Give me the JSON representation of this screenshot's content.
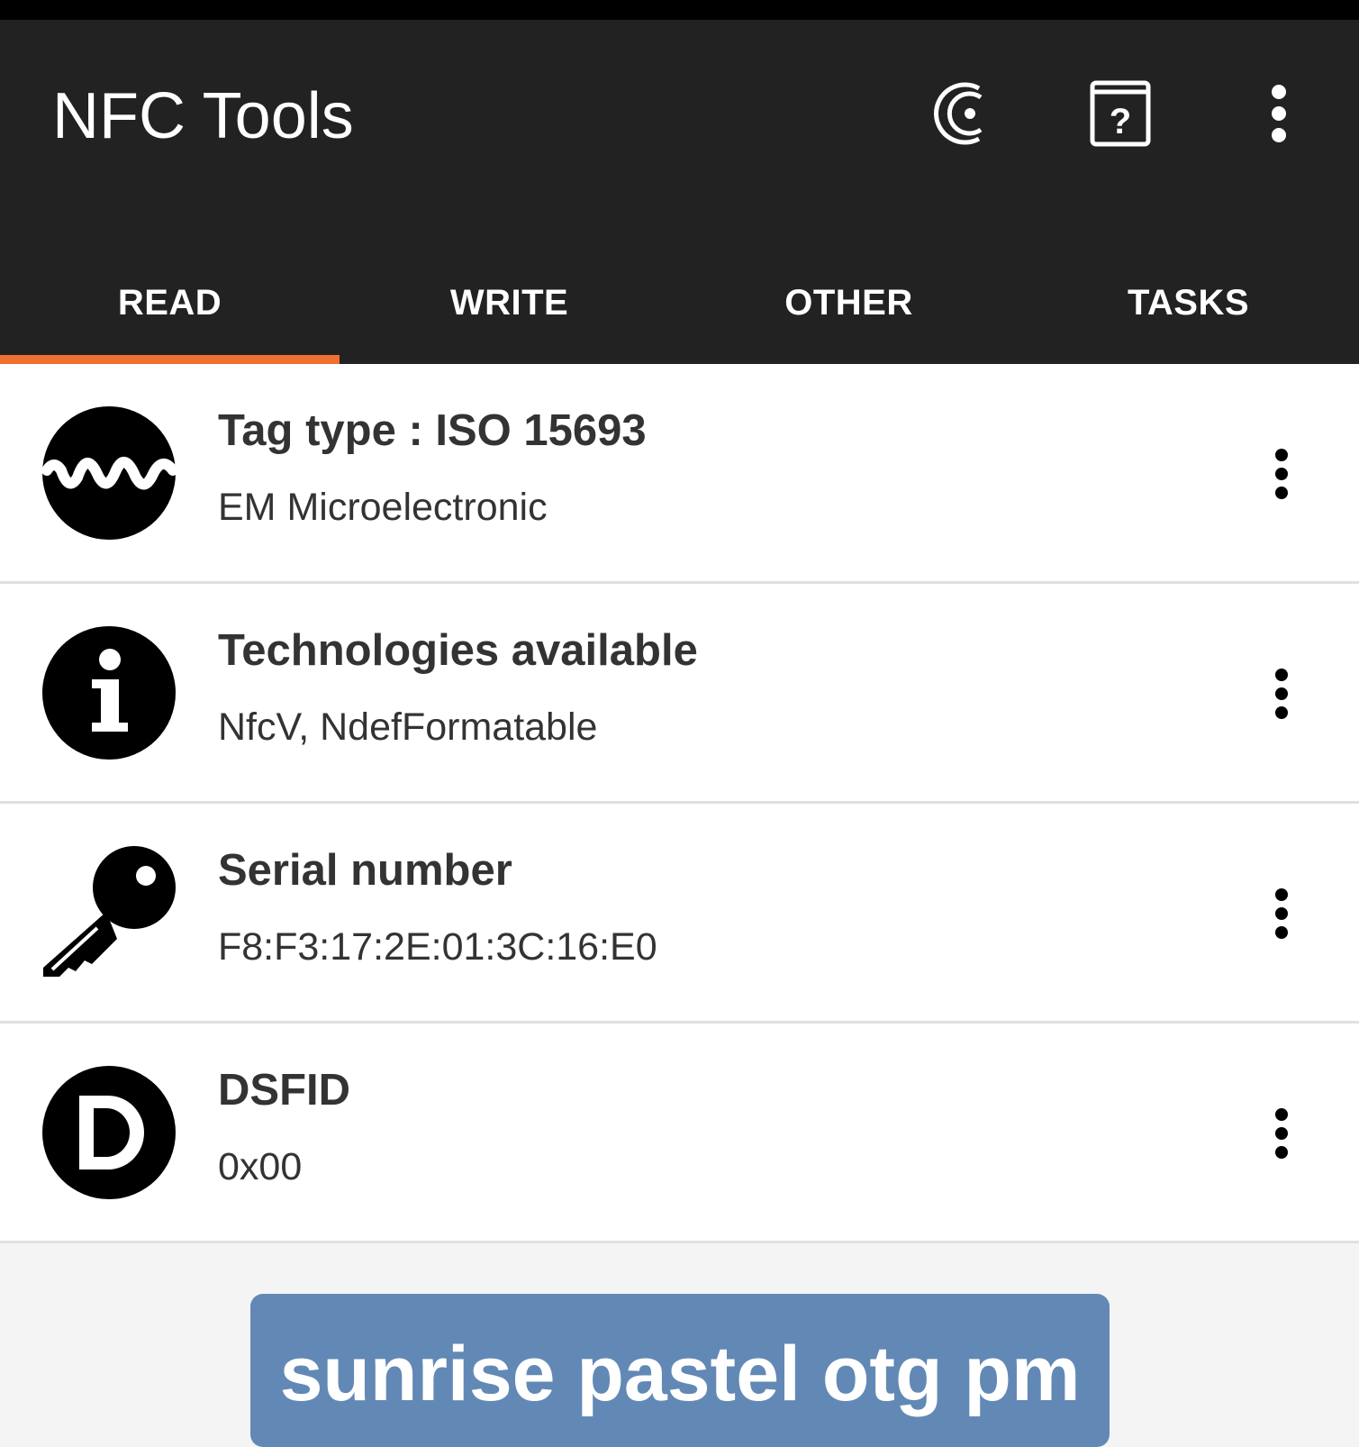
{
  "app": {
    "title": "NFC Tools",
    "actions": [
      {
        "icon": "nfc-c-icon"
      },
      {
        "icon": "help-book-icon"
      },
      {
        "icon": "overflow-menu-icon"
      }
    ]
  },
  "tabs": [
    {
      "label": "READ",
      "active": true
    },
    {
      "label": "WRITE",
      "active": false
    },
    {
      "label": "OTHER",
      "active": false
    },
    {
      "label": "TASKS",
      "active": false
    }
  ],
  "accent_color": "#f07030",
  "rows": [
    {
      "title": "Tag type : ISO 15693",
      "value": "EM Microelectronic",
      "icon": "wave-icon"
    },
    {
      "title": "Technologies available",
      "value": "NfcV, NdefFormatable",
      "icon": "info-icon"
    },
    {
      "title": "Serial number",
      "value": "F8:F3:17:2E:01:3C:16:E0",
      "icon": "key-icon"
    },
    {
      "title": "DSFID",
      "value": "0x00",
      "icon": "d-letter-icon"
    }
  ],
  "banner": {
    "text": "sunrise pastel otg pm",
    "color": "#6289b5"
  }
}
